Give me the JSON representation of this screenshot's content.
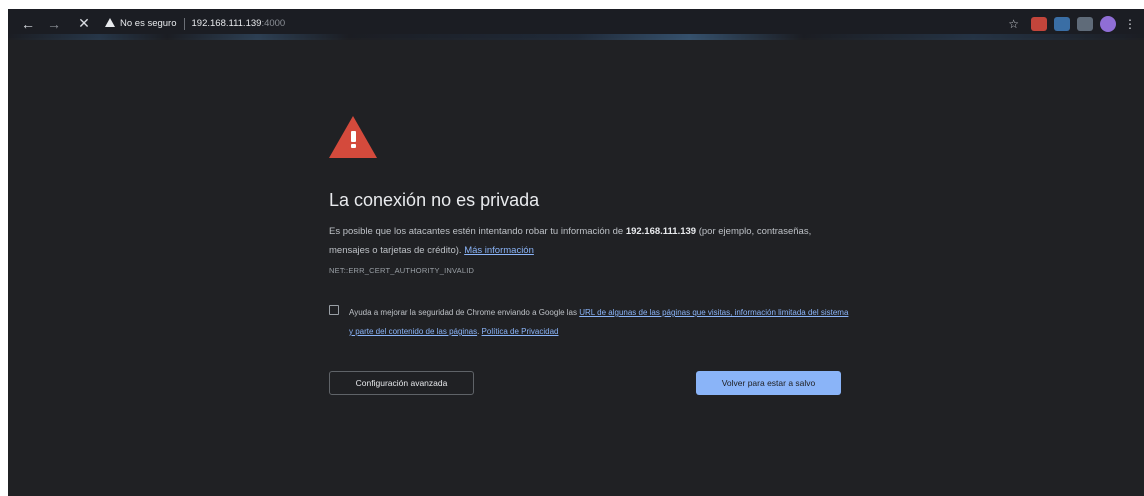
{
  "toolbar": {
    "back_icon": "←",
    "forward_icon": "→",
    "stop_icon": "✕",
    "security_label": "No es seguro",
    "url_host": "192.168.111.139",
    "url_port": ":4000",
    "bookmark_icon": "☆",
    "menu_icon": "⋮"
  },
  "interstitial": {
    "title": "La conexión no es privada",
    "desc_before": "Es posible que los atacantes estén intentando robar tu información de ",
    "host": "192.168.111.139",
    "desc_after": " (por ejemplo, contraseñas, mensajes o tarjetas de crédito). ",
    "more_info_link": "Más información",
    "error_code": "NET::ERR_CERT_AUTHORITY_INVALID",
    "optin_before": "Ayuda a mejorar la seguridad de Chrome enviando a Google las ",
    "optin_link": "URL de algunas de las páginas que visitas, información limitada del sistema y parte del contenido de las páginas",
    "optin_mid": ". ",
    "privacy_link": "Política de Privacidad",
    "advanced_button": "Configuración avanzada",
    "back_button": "Volver para estar a salvo"
  },
  "colors": {
    "background": "#202124",
    "warning_red": "#d44a3c",
    "link_blue": "#8ab4f8",
    "primary_button": "#8ab4f8"
  }
}
